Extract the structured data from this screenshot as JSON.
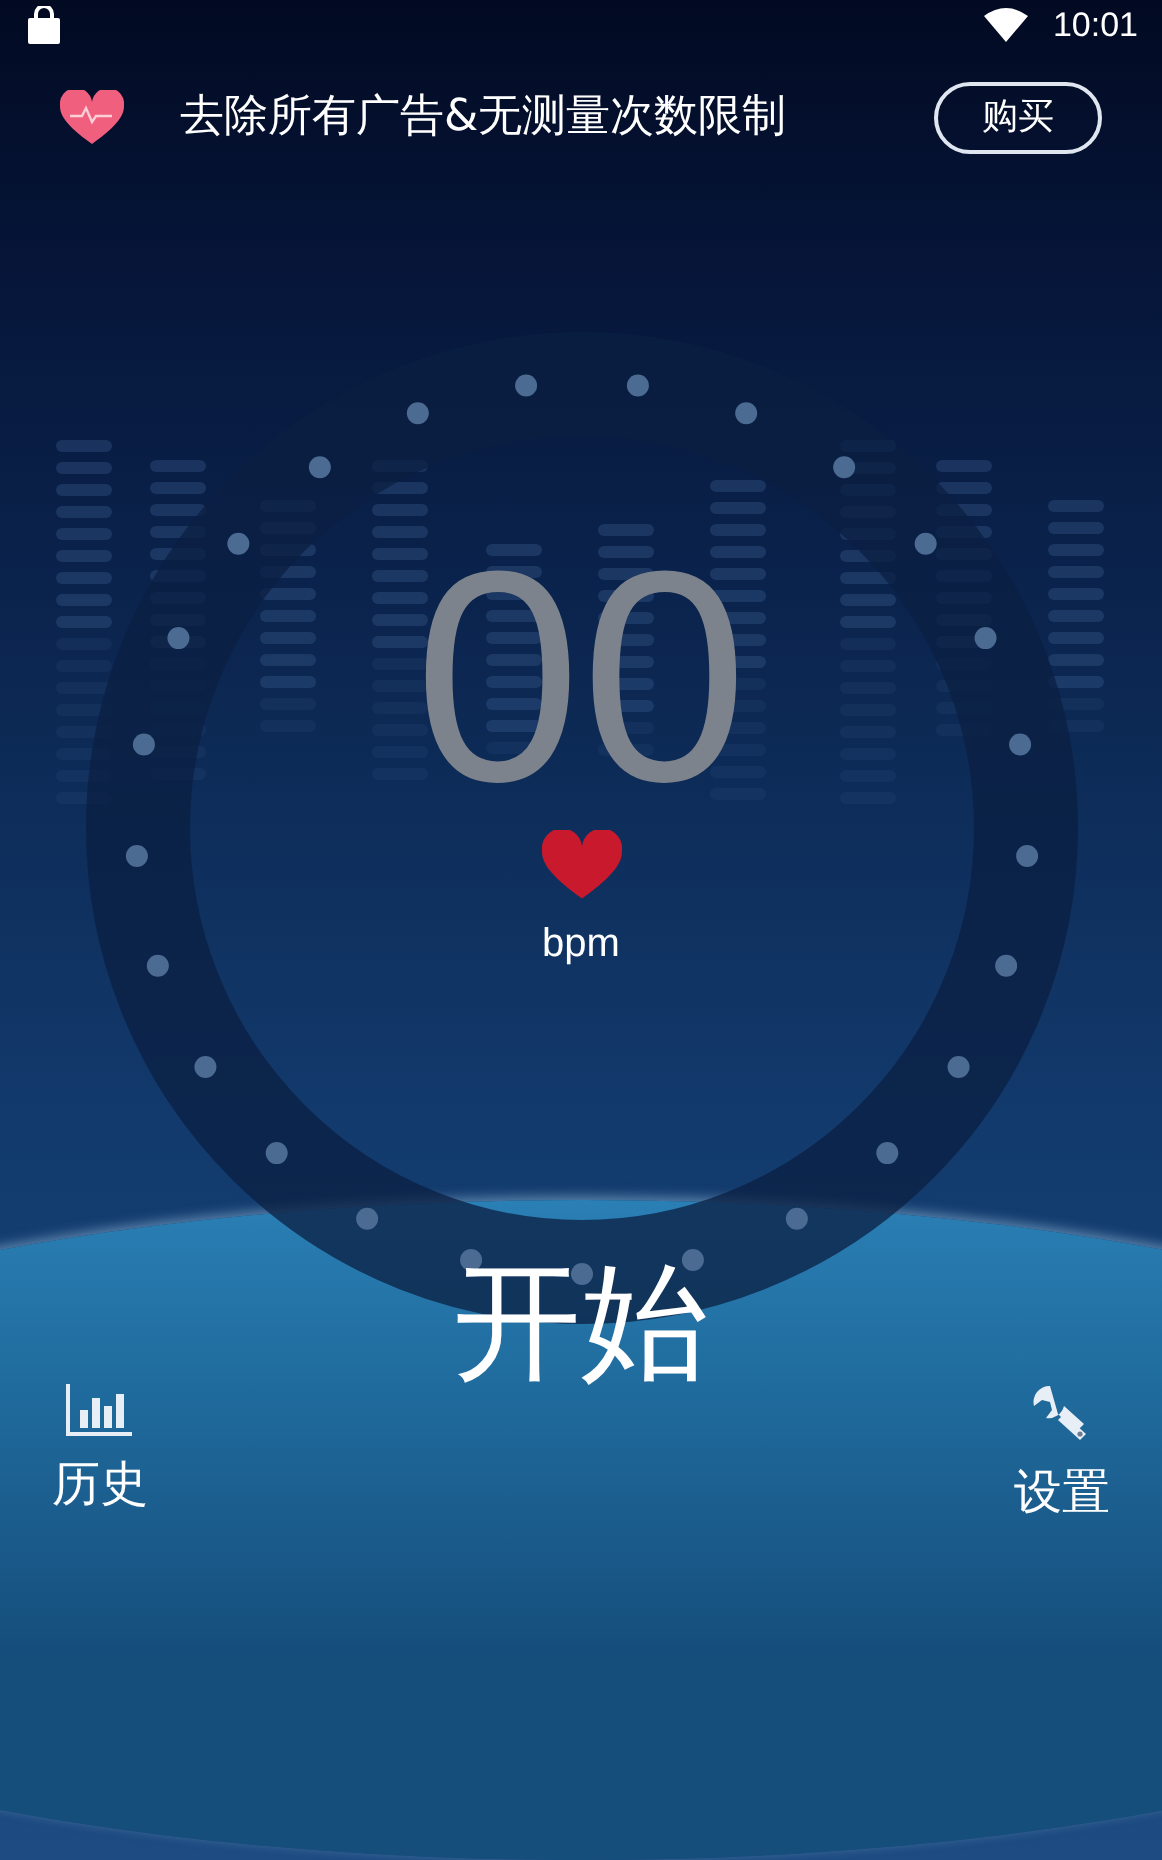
{
  "status_bar": {
    "time": "10:01"
  },
  "promo": {
    "text": "去除所有广告&无测量次数限制",
    "button": "购买"
  },
  "meter": {
    "reading": "00",
    "unit": "bpm"
  },
  "start_button": "开始",
  "nav": [
    {
      "label": "历史",
      "kind": "history"
    },
    {
      "label": "设置",
      "kind": "settings"
    }
  ]
}
